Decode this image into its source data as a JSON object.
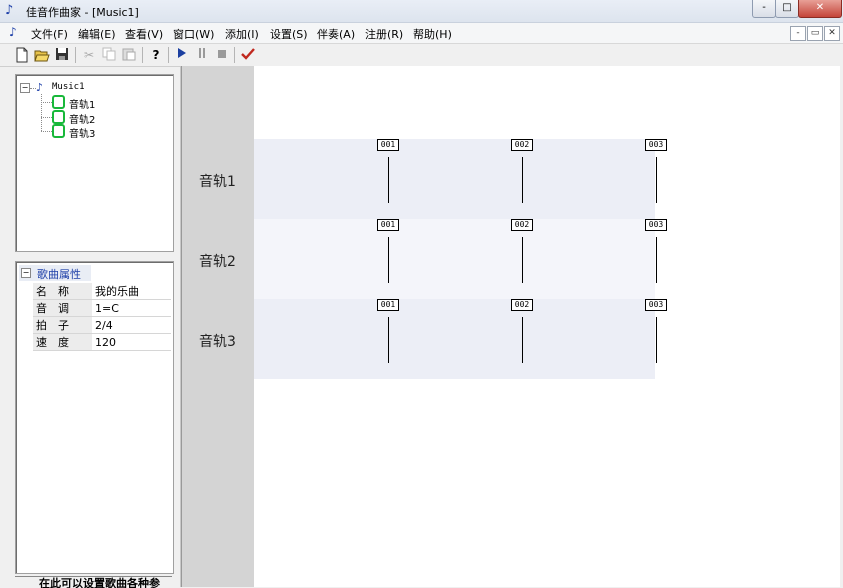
{
  "window": {
    "title": "佳音作曲家 - [Music1]",
    "controls": {
      "minimize": "-",
      "maximize": "□",
      "close": "✕"
    }
  },
  "menu": [
    "文件(F)",
    "编辑(E)",
    "查看(V)",
    "窗口(W)",
    "添加(I)",
    "设置(S)",
    "伴奏(A)",
    "注册(R)",
    "帮助(H)"
  ],
  "mdi_controls": {
    "minimize": "-",
    "restore": "▭",
    "close": "✕"
  },
  "toolbar_icons": [
    "new-file-icon",
    "open-folder-icon",
    "save-icon",
    "cut-icon",
    "copy-icon",
    "paste-icon",
    "help-icon",
    "play-icon",
    "pause-icon",
    "stop-icon",
    "check-icon"
  ],
  "tree": {
    "root": "Music1",
    "expander": "−",
    "tracks": [
      "音轨1",
      "音轨2",
      "音轨3"
    ]
  },
  "properties": {
    "header": "歌曲属性",
    "expander": "−",
    "rows": [
      {
        "key": "名　称",
        "value": "我的乐曲"
      },
      {
        "key": "音　调",
        "value": "1=C"
      },
      {
        "key": "拍　子",
        "value": "2/4"
      },
      {
        "key": "速　度",
        "value": "120"
      }
    ]
  },
  "status_text": "在此可以设置歌曲各种参",
  "score": {
    "tracks": [
      {
        "label": "音轨1",
        "measures": [
          "001",
          "002",
          "003"
        ]
      },
      {
        "label": "音轨2",
        "measures": [
          "001",
          "002",
          "003"
        ]
      },
      {
        "label": "音轨3",
        "measures": [
          "001",
          "002",
          "003"
        ]
      }
    ]
  },
  "colors": {
    "track_band_odd": "#eceef6",
    "track_band_even": "#f4f5fa",
    "track_icon": "#18b83a",
    "play_icon": "#1b3fa0",
    "check_icon": "#c0281e"
  }
}
